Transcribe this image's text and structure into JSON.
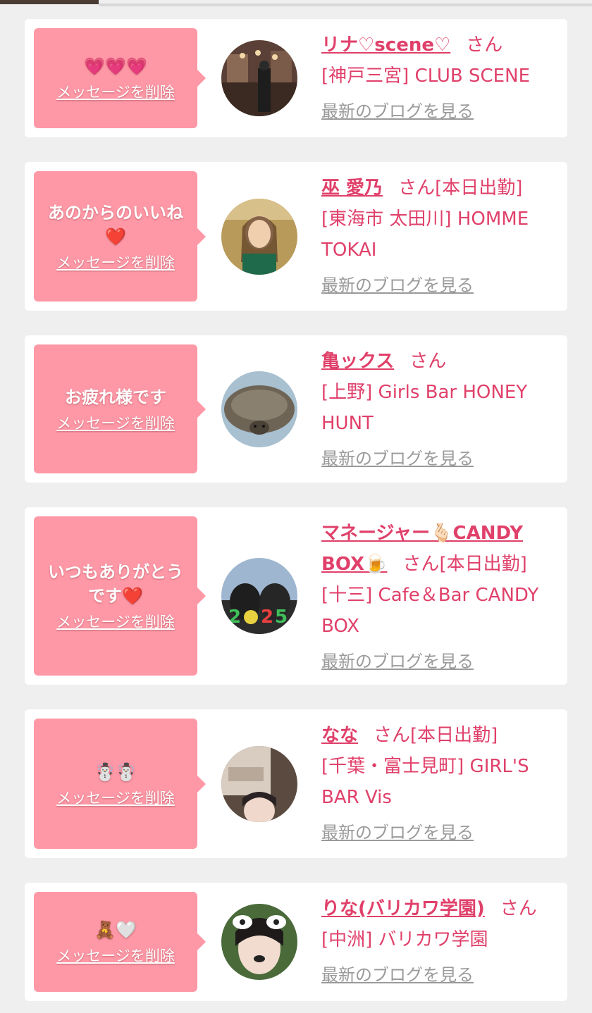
{
  "cards": [
    {
      "message": "💗💗💗",
      "delete_label": "メッセージを削除",
      "name": "リナ♡scene♡",
      "san": "さん",
      "status": "",
      "shop": "[神戸三宮] CLUB SCENE",
      "blog_label": "最新のブログを見る"
    },
    {
      "message": "あのからのいいね\n❤️",
      "delete_label": "メッセージを削除",
      "name": "巫 愛乃",
      "san": "さん",
      "status": "[本日出勤]",
      "shop": "[東海市 太田川] HOMME TOKAI",
      "blog_label": "最新のブログを見る"
    },
    {
      "message": "お疲れ様です",
      "delete_label": "メッセージを削除",
      "name": "亀ックス",
      "san": "さん",
      "status": "",
      "shop": "[上野] Girls Bar HONEY HUNT",
      "blog_label": "最新のブログを見る"
    },
    {
      "message": "いつもありがとう\nです❤️",
      "delete_label": "メッセージを削除",
      "name": "マネージャー🫰🏻CANDY BOX🍺",
      "san": "さん",
      "status": "[本日出勤]",
      "shop": "[十三] Cafe＆Bar CANDY BOX",
      "blog_label": "最新のブログを見る"
    },
    {
      "message": "☃️☃️",
      "delete_label": "メッセージを削除",
      "name": "なな",
      "san": "さん",
      "status": "[本日出勤]",
      "shop": "[千葉・富士見町] GIRL'S BAR Vis",
      "blog_label": "最新のブログを見る"
    },
    {
      "message": "🧸🤍",
      "delete_label": "メッセージを削除",
      "name": "りな(バリカワ学園)",
      "san": "さん",
      "status": "",
      "shop": "[中洲] バリカワ学園",
      "blog_label": "最新のブログを見る"
    }
  ]
}
